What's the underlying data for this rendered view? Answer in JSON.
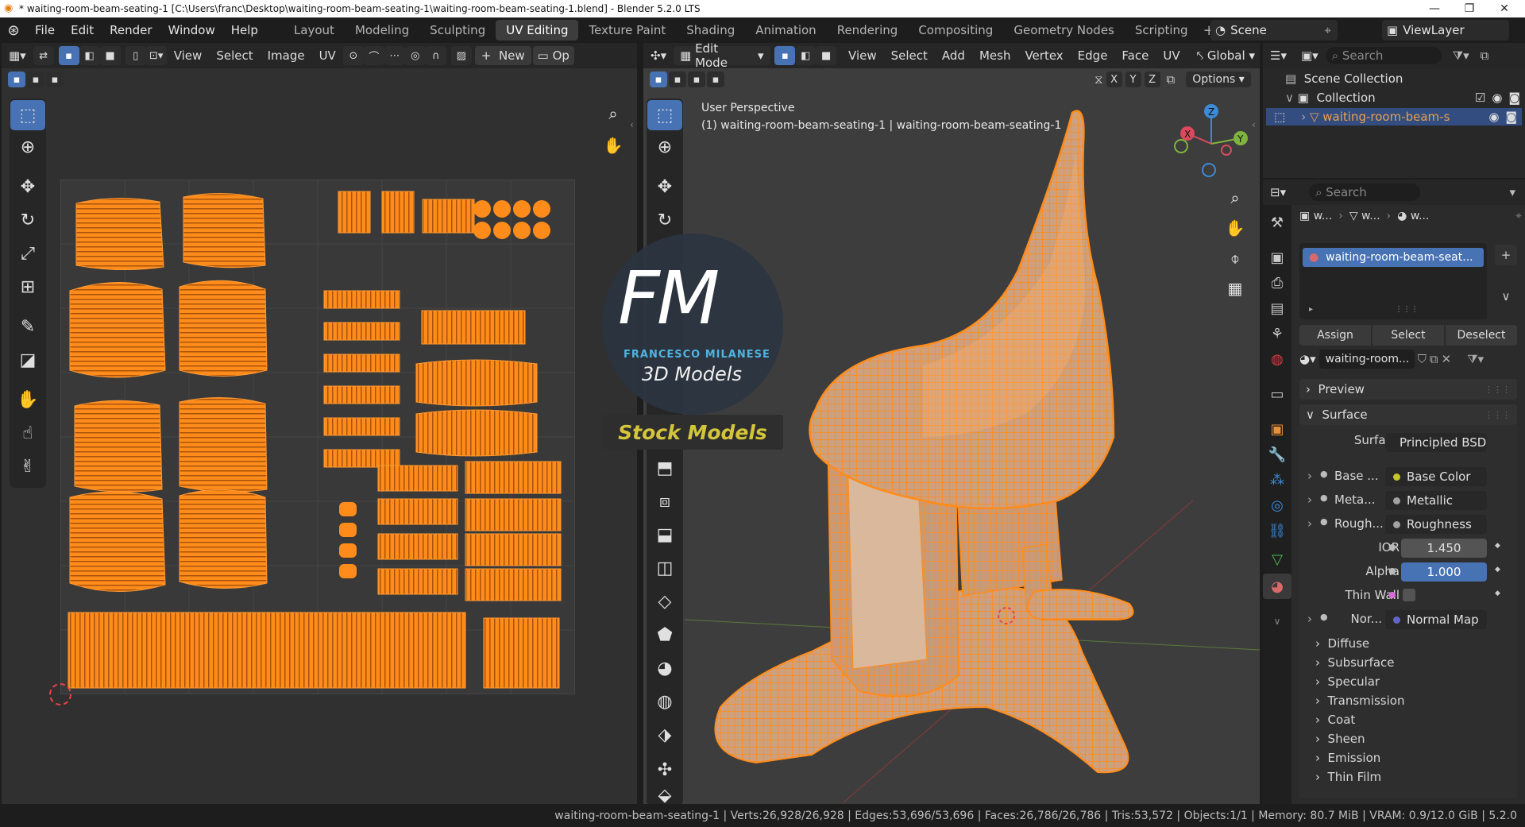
{
  "window": {
    "title": "* waiting-room-beam-seating-1 [C:\\Users\\franc\\Desktop\\waiting-room-beam-seating-1\\waiting-room-beam-seating-1.blend] - Blender 5.2.0 LTS",
    "controls": [
      "—",
      "❐",
      "✕"
    ]
  },
  "menus": [
    "File",
    "Edit",
    "Render",
    "Window",
    "Help"
  ],
  "workspaces": [
    "Layout",
    "Modeling",
    "Sculpting",
    "UV Editing",
    "Texture Paint",
    "Shading",
    "Animation",
    "Rendering",
    "Compositing",
    "Geometry Nodes",
    "Scripting"
  ],
  "active_workspace": "UV Editing",
  "scene": {
    "label": "Scene",
    "viewlayer": "ViewLayer"
  },
  "uv_editor": {
    "menus": [
      "View",
      "Select",
      "Image",
      "UV"
    ],
    "new_label": "New",
    "open_label": "Op"
  },
  "viewport": {
    "mode": "Edit Mode",
    "menus": [
      "View",
      "Select",
      "Add",
      "Mesh",
      "Vertex",
      "Edge",
      "Face",
      "UV"
    ],
    "orientation": "Global",
    "options_label": "Options",
    "xyz": [
      "X",
      "Y",
      "Z"
    ],
    "overlay_line1": "User Perspective",
    "overlay_line2": "(1) waiting-room-beam-seating-1 | waiting-room-beam-seating-1",
    "gizmo": {
      "z": "Z",
      "y": "Y",
      "x": "X"
    }
  },
  "watermark": {
    "initials": "FM",
    "name": "FRANCESCO MILANESE",
    "models": "3D Models",
    "stock": "Stock Models"
  },
  "outliner": {
    "search_placeholder": "Search",
    "scene_collection": "Scene Collection",
    "collection": "Collection",
    "object": "waiting-room-beam-s"
  },
  "properties": {
    "search_placeholder": "Search",
    "breadcrumb": [
      "w...",
      "w...",
      "w..."
    ],
    "material_slot": "waiting-room-beam-seat...",
    "buttons": {
      "assign": "Assign",
      "select": "Select",
      "deselect": "Deselect"
    },
    "material_name": "waiting-room...",
    "preview": "Preview",
    "surface_section": "Surface",
    "surface_label": "Surface",
    "surface_value": "Principled BSDF",
    "rows": [
      {
        "label": "Base ...",
        "value": "Base Color",
        "dot": "#c7c429"
      },
      {
        "label": "Meta...",
        "value": "Metallic",
        "dot": "#a1a1a1"
      },
      {
        "label": "Rough...",
        "value": "Roughness",
        "dot": "#a1a1a1"
      }
    ],
    "ior": {
      "label": "IOR",
      "value": "1.450"
    },
    "alpha": {
      "label": "Alpha",
      "value": "1.000"
    },
    "thinwall": {
      "label": "Thin Wall"
    },
    "normal": {
      "label": "Nor...",
      "value": "Normal Map"
    },
    "subpanels": [
      "Diffuse",
      "Subsurface",
      "Specular",
      "Transmission",
      "Coat",
      "Sheen",
      "Emission",
      "Thin Film"
    ]
  },
  "status": {
    "text": "waiting-room-beam-seating-1 | Verts:26,928/26,928 | Edges:53,696/53,696 | Faces:26,786/26,786 | Tris:53,572 | Objects:1/1 | Memory: 80.7 MiB | VRAM: 0.9/12.0 GiB | 5.2.0"
  },
  "colors": {
    "accent": "#4772b3",
    "mesh": "#ff8c1a",
    "header": "#262626",
    "panel": "#303030"
  }
}
